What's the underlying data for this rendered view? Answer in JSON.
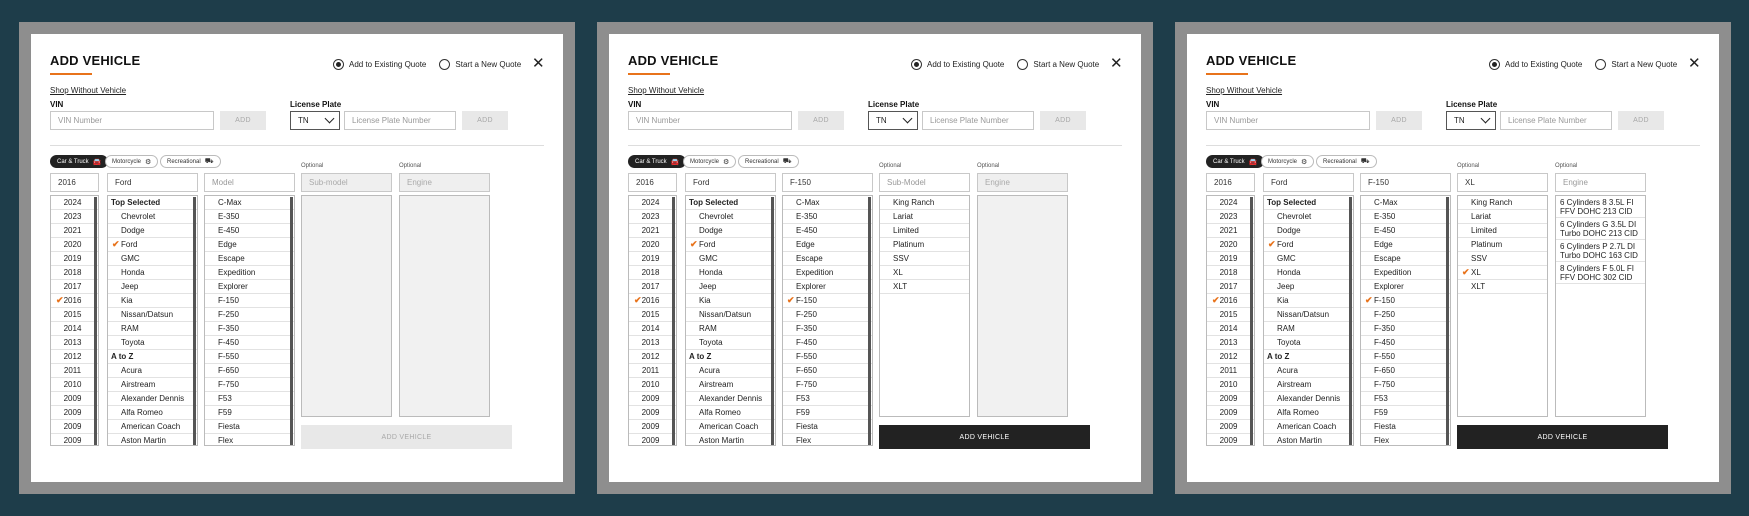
{
  "modal": {
    "title": "ADD VEHICLE",
    "radio_existing": "Add to Existing Quote",
    "radio_new": "Start a New Quote",
    "close": "✕",
    "shop_link": "Shop Without Vehicle",
    "vin_label": "VIN",
    "vin_placeholder": "VIN Number",
    "add_label": "ADD",
    "plate_label": "License Plate",
    "state_value": "TN",
    "plate_placeholder": "License Plate Number",
    "chip_car": "Car & Truck",
    "chip_moto": "Motorcycle",
    "chip_rec": "Recreational",
    "optional": "Optional",
    "add_vehicle": "ADD VEHICLE"
  },
  "lists": {
    "years": [
      "2024",
      "2023",
      "2021",
      "2020",
      "2019",
      "2018",
      "2017",
      "2016",
      "2015",
      "2014",
      "2013",
      "2012",
      "2011",
      "2010",
      "2009",
      "2009",
      "2009",
      "2009"
    ],
    "selected_year": "2016",
    "makes_top_heading": "Top Selected",
    "makes_top": [
      "Chevrolet",
      "Dodge",
      "Ford",
      "GMC",
      "Honda",
      "Jeep",
      "Kia",
      "Nissan/Datsun",
      "RAM",
      "Toyota"
    ],
    "makes_az_heading": "A to Z",
    "makes_az": [
      "Acura",
      "Airstream",
      "Alexander Dennis",
      "Alfa Romeo",
      "American Coach",
      "Aston Martin"
    ],
    "selected_make": "Ford",
    "models": [
      "C-Max",
      "E-350",
      "E-450",
      "Edge",
      "Escape",
      "Expedition",
      "Explorer",
      "F-150",
      "F-250",
      "F-350",
      "F-450",
      "F-550",
      "F-650",
      "F-750",
      "F53",
      "F59",
      "Fiesta",
      "Flex"
    ],
    "selected_model": "F-150",
    "submodels": [
      "King Ranch",
      "Lariat",
      "Limited",
      "Platinum",
      "SSV",
      "XL",
      "XLT"
    ],
    "selected_submodel": "XL",
    "engines": [
      "6 Cylinders 8 3.5L FI FFV DOHC 213 CID",
      "6 Cylinders G 3.5L DI Turbo DOHC 213 CID",
      "6 Cylinders P 2.7L DI Turbo DOHC 163 CID",
      "8 Cylinders F 5.0L FI FFV DOHC 302 CID"
    ]
  },
  "panels": [
    {
      "year_value": "2016",
      "make_value": "Ford",
      "model_value": "",
      "model_placeholder": "Model",
      "sub_value": "",
      "sub_placeholder": "Sub-model",
      "engine_value": "",
      "engine_placeholder": "Engine",
      "add_enabled": false
    },
    {
      "year_value": "2016",
      "make_value": "Ford",
      "model_value": "F-150",
      "model_placeholder": "Model",
      "sub_value": "",
      "sub_placeholder": "Sub-Model",
      "engine_value": "",
      "engine_placeholder": "Engine",
      "add_enabled": true
    },
    {
      "year_value": "2016",
      "make_value": "Ford",
      "model_value": "F-150",
      "model_placeholder": "Model",
      "sub_value": "XL",
      "sub_placeholder": "Sub-Model",
      "engine_value": "",
      "engine_placeholder": "Engine",
      "add_enabled": true
    }
  ],
  "colors": {
    "background": "#1e3d4a",
    "accent": "#e8731b",
    "button_dark": "#222222"
  },
  "icons": {
    "close": "close-icon",
    "car": "car-icon",
    "moto": "motorcycle-icon",
    "rec": "recreational-icon",
    "check": "check-icon"
  }
}
